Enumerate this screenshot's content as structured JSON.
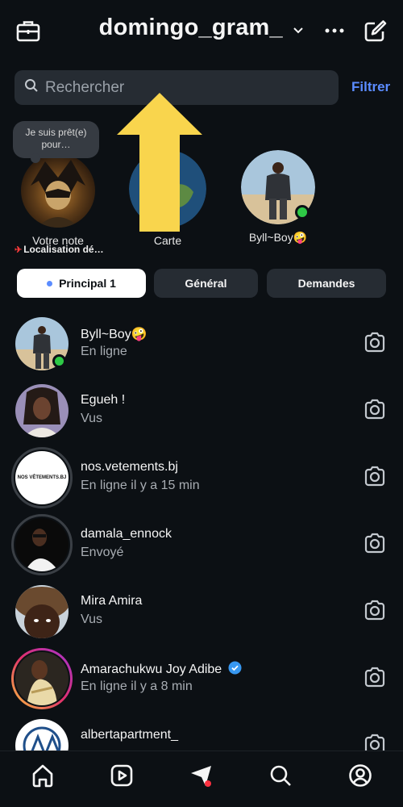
{
  "header": {
    "username": "domingo_gram_",
    "icons": [
      "briefcase-icon",
      "chevron-down-icon",
      "more-icon",
      "compose-icon"
    ]
  },
  "search": {
    "placeholder": "Rechercher",
    "filter_label": "Filtrer"
  },
  "stories": {
    "note_text": "Je suis prêt(e) pour…",
    "items": [
      {
        "label": "Votre note",
        "sublabel": "Localisation dé…"
      },
      {
        "label": "Carte"
      },
      {
        "label": "Byll~Boy🤪",
        "online": true
      }
    ]
  },
  "tabs": [
    {
      "label": "Principal 1",
      "active": true
    },
    {
      "label": "Général",
      "active": false
    },
    {
      "label": "Demandes",
      "active": false
    }
  ],
  "conversations": [
    {
      "name": "Byll~Boy🤪",
      "status": "En ligne",
      "online": true
    },
    {
      "name": "Egueh !",
      "status": "Vus"
    },
    {
      "name": "nos.vetements.bj",
      "status": "En ligne il y a 15 min",
      "logo_text": "NOS VÊTEMENTS.BJ"
    },
    {
      "name": "damala_ennock",
      "status": "Envoyé"
    },
    {
      "name": "Mira Amira",
      "status": "Vus"
    },
    {
      "name": "Amarachukwu Joy Adibe",
      "status": "En ligne il y a 8 min",
      "verified": true
    },
    {
      "name": "albertapartment_",
      "status": ""
    }
  ],
  "bottom_nav": [
    "home-icon",
    "reels-icon",
    "direct-messages-icon",
    "search-icon",
    "profile-icon"
  ],
  "colors": {
    "background": "#0c1014",
    "accent": "#5b8cff",
    "online": "#2ec946",
    "arrow": "#f9d54d"
  }
}
